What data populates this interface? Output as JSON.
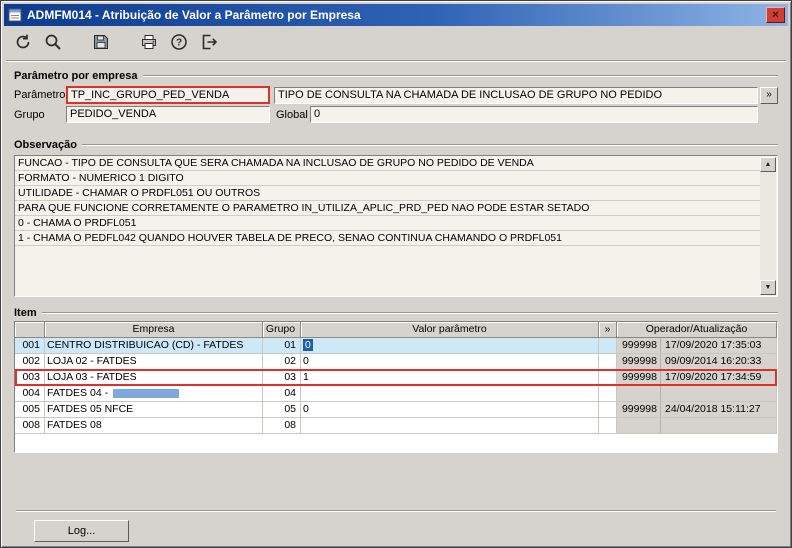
{
  "window": {
    "title": "ADMFM014 - Atribuição de Valor a Parâmetro por Empresa",
    "close_glyph": "×"
  },
  "toolbar": {
    "buttons": [
      "undo",
      "search",
      "save",
      "print",
      "help",
      "exit"
    ]
  },
  "param_group": {
    "title": "Parâmetro por empresa",
    "param_label": "Parâmetro",
    "param_value": "TP_INC_GRUPO_PED_VENDA",
    "param_desc": "TIPO DE CONSULTA NA CHAMADA DE INCLUSAO DE GRUPO NO PEDIDO",
    "expand_button": "»",
    "grupo_label": "Grupo",
    "grupo_value": "PEDIDO_VENDA",
    "global_label": "Global",
    "global_value": "0"
  },
  "obs_group": {
    "title": "Observação",
    "up_arrow": "▲",
    "down_arrow": "▼",
    "lines": [
      "FUNCAO - TIPO DE CONSULTA QUE SERA CHAMADA NA INCLUSAO DE GRUPO NO PEDIDO DE VENDA",
      "FORMATO - NUMERICO 1 DIGITO",
      "UTILIDADE - CHAMAR O PRDFL051 OU OUTROS",
      "PARA QUE FUNCIONE CORRETAMENTE O PARAMETRO IN_UTILIZA_APLIC_PRD_PED NAO PODE ESTAR SETADO",
      "0 - CHAMA O PRDFL051",
      "1 - CHAMA O PEDFL042 QUANDO HOUVER TABELA DE PRECO, SENAO CONTINUA CHAMANDO O PRDFL051"
    ]
  },
  "item_group": {
    "title": "Item",
    "headers": {
      "empresa": "Empresa",
      "grupo": "Grupo",
      "valor": "Valor parâmetro",
      "expand": "»",
      "operador": "Operador/Atualização"
    },
    "rows": [
      {
        "num": "001",
        "empresa": "CENTRO DISTRIBUICAO (CD) - FATDES",
        "grupo": "01",
        "valor": "0",
        "operador": "999998",
        "atualizacao": "17/09/2020 17:35:03"
      },
      {
        "num": "002",
        "empresa": "LOJA 02 - FATDES",
        "grupo": "02",
        "valor": "0",
        "operador": "999998",
        "atualizacao": "09/09/2014 16:20:33"
      },
      {
        "num": "003",
        "empresa": "LOJA 03 - FATDES",
        "grupo": "03",
        "valor": "1",
        "operador": "999998",
        "atualizacao": "17/09/2020 17:34:59"
      },
      {
        "num": "004",
        "empresa": "FATDES 04 - ",
        "grupo": "04",
        "valor": "",
        "operador": "",
        "atualizacao": ""
      },
      {
        "num": "005",
        "empresa": "FATDES 05 NFCE",
        "grupo": "05",
        "valor": "0",
        "operador": "999998",
        "atualizacao": "24/04/2018 15:11:27"
      },
      {
        "num": "008",
        "empresa": "FATDES 08",
        "grupo": "08",
        "valor": "",
        "operador": "",
        "atualizacao": ""
      }
    ]
  },
  "footer": {
    "log_button": "Log..."
  }
}
